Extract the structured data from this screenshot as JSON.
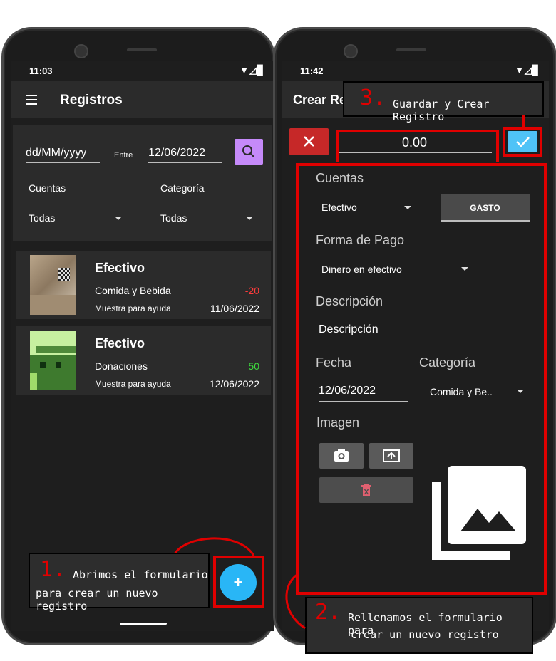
{
  "left": {
    "status": {
      "time": "11:03",
      "icons": "▼◿▊"
    },
    "toolbar": {
      "title": "Registros"
    },
    "filters": {
      "date_from_placeholder": "dd/MM/yyyy",
      "between_label": "Entre",
      "date_to_value": "12/06/2022",
      "cuentas_label": "Cuentas",
      "cuentas_value": "Todas",
      "categoria_label": "Categoría",
      "categoria_value": "Todas"
    },
    "records": [
      {
        "account": "Efectivo",
        "category": "Comida y Bebida",
        "amount": "-20",
        "amount_color": "#ff3b3b",
        "note": "Muestra para ayuda",
        "date": "11/06/2022"
      },
      {
        "account": "Efectivo",
        "category": "Donaciones",
        "amount": "50",
        "amount_color": "#3ddc3d",
        "note": "Muestra para ayuda",
        "date": "12/06/2022"
      }
    ],
    "fab_label": "+"
  },
  "right": {
    "status": {
      "time": "11:42",
      "icons": "▼◿▊"
    },
    "toolbar": {
      "title": "Crear Re"
    },
    "amount_value": "0.00",
    "form": {
      "cuentas_label": "Cuentas",
      "cuenta_value": "Efectivo",
      "type_button": "GASTO",
      "forma_pago_label": "Forma de Pago",
      "forma_pago_value": "Dinero en efectivo",
      "descripcion_label": "Descripción",
      "descripcion_value": "Descripción",
      "fecha_label": "Fecha",
      "fecha_value": "12/06/2022",
      "categoria_label": "Categoría",
      "categoria_value": "Comida y Be..",
      "imagen_label": "Imagen"
    }
  },
  "annotations": {
    "step1": {
      "number": "1.",
      "line1": "Abrimos el formulario",
      "line2": "para crear un nuevo registro"
    },
    "step2": {
      "number": "2.",
      "line1": "Rellenamos el formulario para",
      "line2": "crear un nuevo registro"
    },
    "step3": {
      "number": "3.",
      "text": "Guardar y Crear Registro"
    }
  },
  "colors": {
    "accent_red": "#e00000",
    "search_purple": "#c58af9",
    "fab_blue": "#29b6f6",
    "confirm_blue": "#4fc3f7",
    "cancel_red": "#c62828"
  }
}
